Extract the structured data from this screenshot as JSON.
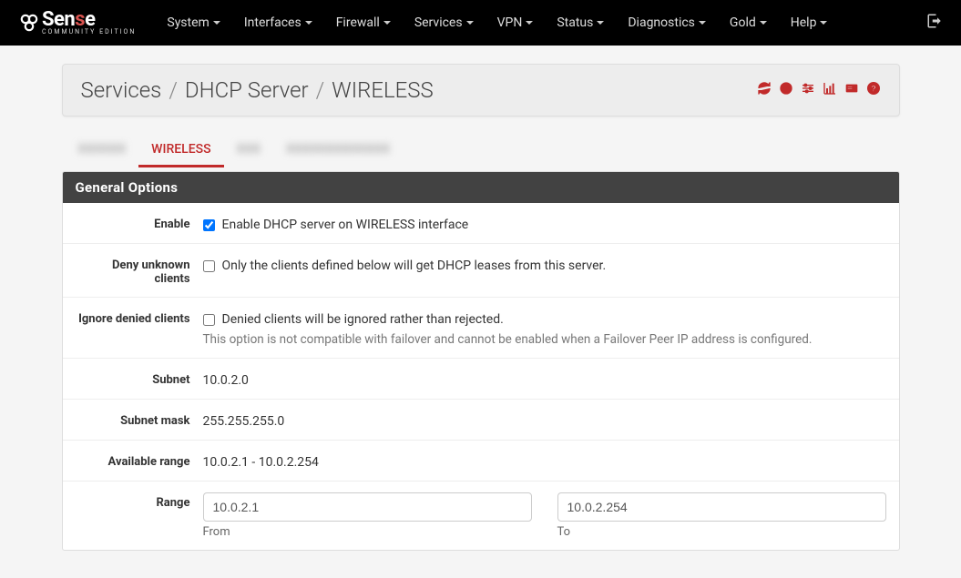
{
  "nav": [
    {
      "label": "System"
    },
    {
      "label": "Interfaces"
    },
    {
      "label": "Firewall"
    },
    {
      "label": "Services"
    },
    {
      "label": "VPN"
    },
    {
      "label": "Status"
    },
    {
      "label": "Diagnostics"
    },
    {
      "label": "Gold"
    },
    {
      "label": "Help"
    }
  ],
  "breadcrumb": {
    "item1": "Services",
    "item2": "DHCP Server",
    "item3": "WIRELESS"
  },
  "tabs": {
    "t0": "XXXXXX",
    "t1": "WIRELESS",
    "t2": "XXX",
    "t3": "XXXXXXXXXXXXX"
  },
  "panel": {
    "title": "General Options",
    "enable_label": "Enable",
    "enable_text": "Enable DHCP server on WIRELESS interface",
    "enable_checked": true,
    "deny_label": "Deny unknown clients",
    "deny_text": "Only the clients defined below will get DHCP leases from this server.",
    "deny_checked": false,
    "ignore_label": "Ignore denied clients",
    "ignore_text": "Denied clients will be ignored rather than rejected.",
    "ignore_help": "This option is not compatible with failover and cannot be enabled when a Failover Peer IP address is configured.",
    "ignore_checked": false,
    "subnet_label": "Subnet",
    "subnet_value": "10.0.2.0",
    "mask_label": "Subnet mask",
    "mask_value": "255.255.255.0",
    "avail_label": "Available range",
    "avail_value": "10.0.2.1 - 10.0.2.254",
    "range_label": "Range",
    "range_from": "10.0.2.1",
    "range_from_label": "From",
    "range_to": "10.0.2.254",
    "range_to_label": "To"
  }
}
